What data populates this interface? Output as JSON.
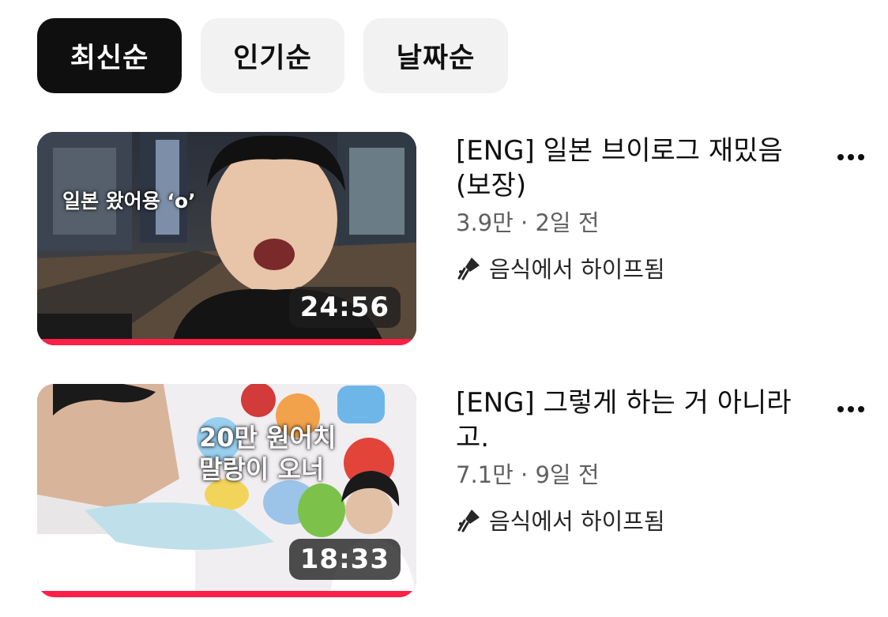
{
  "sort_chips": [
    {
      "label": "최신순",
      "active": true
    },
    {
      "label": "인기순",
      "active": false
    },
    {
      "label": "날짜순",
      "active": false
    }
  ],
  "videos": [
    {
      "title": "[ENG] 일본 브이로그 재밌음 (보장)",
      "views": "3.9만",
      "separator": "·",
      "age": "2일 전",
      "hype_label": "음식에서 하이프됨",
      "duration": "24:56",
      "thumbnail_text": [
        "일본 왔어용 ‘o’"
      ],
      "progress_percent": 100,
      "progress_color": "#ff1f47"
    },
    {
      "title": "[ENG] 그렇게 하는 거 아니라고.",
      "views": "7.1만",
      "separator": "·",
      "age": "9일 전",
      "hype_label": "음식에서 하이프됨",
      "duration": "18:33",
      "thumbnail_text": [
        "20만 원어치",
        "말랑이 오너"
      ],
      "progress_percent": 100,
      "progress_color": "#ff1f47"
    }
  ],
  "icons": {
    "more": "more-vert-icon",
    "hype": "hype-rocket-icon"
  }
}
